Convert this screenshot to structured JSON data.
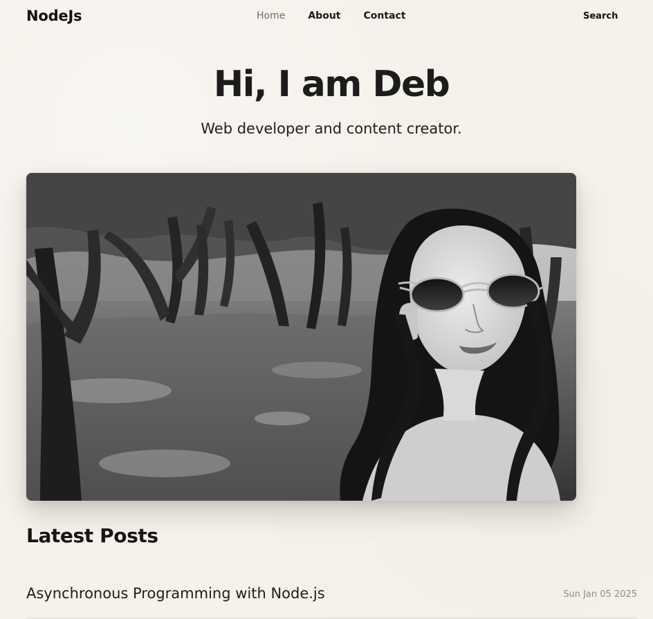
{
  "header": {
    "logo": "NodeJs",
    "nav": [
      {
        "label": "Home",
        "active": true
      },
      {
        "label": "About",
        "active": false
      },
      {
        "label": "Contact",
        "active": false
      }
    ],
    "search_label": "Search"
  },
  "hero": {
    "title": "Hi, I am Deb",
    "subtitle": "Web developer and content creator."
  },
  "posts": {
    "section_title": "Latest Posts",
    "items": [
      {
        "title": "Asynchronous Programming with Node.js",
        "date": "Sun Jan 05 2025"
      }
    ]
  },
  "colors": {
    "background": "#f5f1eb",
    "text": "#1d1d1d",
    "nav_active": "#6f6f6f",
    "date": "#8d8d8d"
  }
}
